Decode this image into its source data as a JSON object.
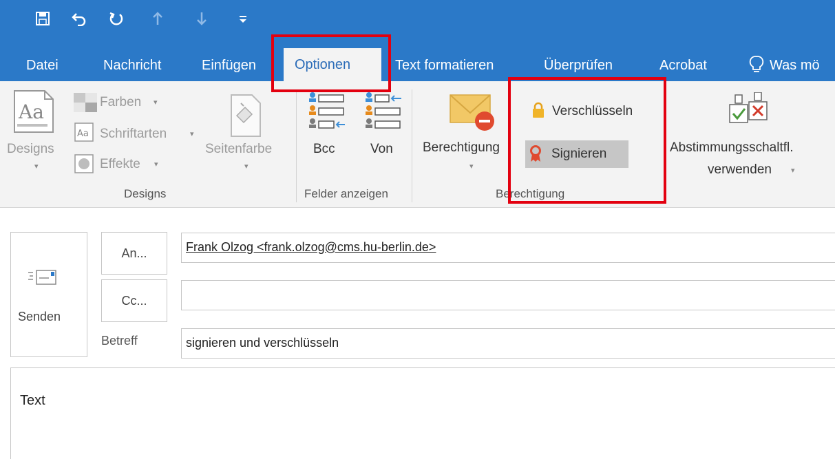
{
  "qat": {
    "save_icon": "save-icon",
    "undo_icon": "undo-icon",
    "redo_icon": "redo-icon",
    "up_icon": "arrow-up-icon",
    "down_icon": "arrow-down-icon",
    "customize_icon": "customize-qat-icon"
  },
  "tabs": {
    "datei": "Datei",
    "nachricht": "Nachricht",
    "einfuegen": "Einfügen",
    "optionen": "Optionen",
    "text_formatieren": "Text formatieren",
    "ueberpruefen": "Überprüfen",
    "acrobat": "Acrobat",
    "tell_me": "Was mö"
  },
  "ribbon": {
    "designs_label": "Designs",
    "farben": "Farben",
    "schriftarten": "Schriftarten",
    "effekte": "Effekte",
    "seitenfarbe": "Seitenfarbe",
    "group_designs": "Designs",
    "bcc": "Bcc",
    "von": "Von",
    "group_felder": "Felder anzeigen",
    "berechtigung": "Berechtigung",
    "verschluesseln": "Verschlüsseln",
    "signieren": "Signieren",
    "group_berechtigung": "Berechtigung",
    "abstimmung_line1": "Abstimmungsschaltfl.",
    "abstimmung_line2": "verwenden"
  },
  "compose": {
    "send_label": "Senden",
    "an_button": "An...",
    "cc_button": "Cc...",
    "betreff_label": "Betreff",
    "to_value": "Frank Olzog <frank.olzog@cms.hu-berlin.de>",
    "cc_value": "",
    "subject_value": "signieren und verschlüsseln",
    "body_text": "Text"
  },
  "colors": {
    "accent": "#2b79c8",
    "highlight": "#e3000f",
    "ribbon_bg": "#f3f3f3"
  }
}
